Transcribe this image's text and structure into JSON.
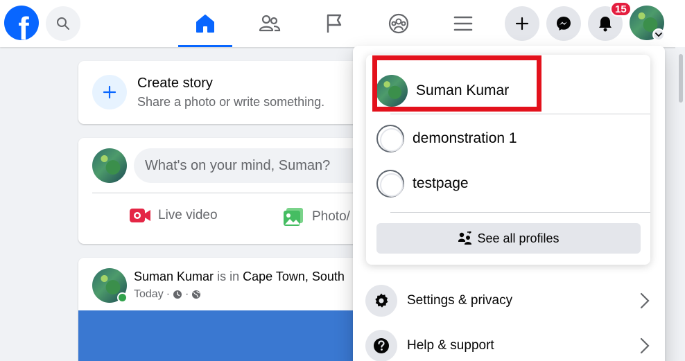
{
  "header": {
    "logo": "f",
    "icons": {
      "search": "search-icon",
      "home": "home-icon",
      "friends": "friends-icon",
      "pages": "flag-icon",
      "groups": "groups-icon",
      "menu": "menu-icon",
      "create": "plus-icon",
      "messenger": "messenger-icon",
      "notifications": "bell-icon"
    },
    "notification_count": "15",
    "accent_color": "#0866ff"
  },
  "feed": {
    "create_story": {
      "title": "Create story",
      "subtitle": "Share a photo or write something."
    },
    "composer": {
      "placeholder": "What's on your mind, Suman?",
      "actions": [
        {
          "label": "Live video",
          "icon": "live-video-icon"
        },
        {
          "label": "Photo/",
          "icon": "photo-icon"
        }
      ]
    },
    "post": {
      "author": "Suman Kumar",
      "connector": "is in",
      "location": "Cape Town, South",
      "time": "Today",
      "separator": "·"
    }
  },
  "dropdown": {
    "profiles": [
      {
        "name": "Suman Kumar",
        "type": "user"
      },
      {
        "name": "demonstration 1",
        "type": "page"
      },
      {
        "name": "testpage",
        "type": "page"
      }
    ],
    "see_all": "See all profiles",
    "menu": [
      {
        "label": "Settings & privacy",
        "icon": "gear-icon"
      },
      {
        "label": "Help & support",
        "icon": "help-icon"
      }
    ]
  }
}
